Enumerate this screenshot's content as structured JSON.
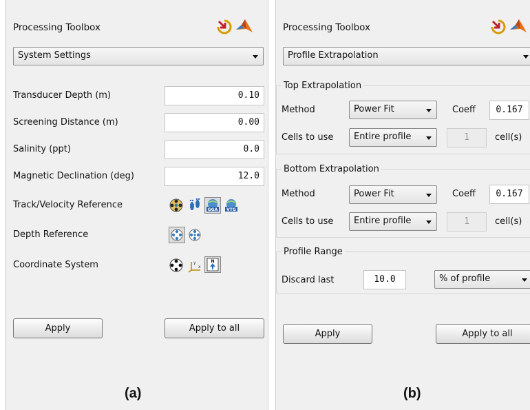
{
  "panel_a": {
    "title": "Processing Toolbox",
    "category": "System Settings",
    "fields": [
      {
        "label": "Transducer Depth (m)",
        "value": "0.10"
      },
      {
        "label": "Screening Distance (m)",
        "value": "0.00"
      },
      {
        "label": "Salinity (ppt)",
        "value": "0.0"
      },
      {
        "label": "Magnetic Declination (deg)",
        "value": "12.0"
      }
    ],
    "track_reference_label": "Track/Velocity Reference",
    "track_reference_icons": [
      "bottom-track-icon",
      "footprints-icon",
      "gga-icon",
      "vtg-icon"
    ],
    "track_reference_gga_text": "GGA",
    "track_reference_vtg_text": "VTG",
    "depth_reference_label": "Depth Reference",
    "depth_reference_icons": [
      "depth-average-icon",
      "depth-beams-icon"
    ],
    "coordinate_system_label": "Coordinate System",
    "coordinate_system_icons": [
      "beam-coordinates-icon",
      "xyz-axes-icon",
      "north-arrow-icon"
    ],
    "north_text": "N",
    "apply_label": "Apply",
    "apply_all_label": "Apply to all",
    "caption": "(a)"
  },
  "panel_b": {
    "title": "Processing Toolbox",
    "category": "Profile Extrapolation",
    "top": {
      "group_title": "Top Extrapolation",
      "method_label": "Method",
      "method_value": "Power Fit",
      "coeff_label": "Coeff",
      "coeff_value": "0.167",
      "cells_label": "Cells to use",
      "cells_value": "Entire profile",
      "cells_count": "1",
      "cells_unit": "cell(s)"
    },
    "bottom": {
      "group_title": "Bottom Extrapolation",
      "method_label": "Method",
      "method_value": "Power Fit",
      "coeff_label": "Coeff",
      "coeff_value": "0.167",
      "cells_label": "Cells to use",
      "cells_value": "Entire profile",
      "cells_count": "1",
      "cells_unit": "cell(s)"
    },
    "range": {
      "group_title": "Profile Range",
      "discard_label": "Discard last",
      "discard_value": "10.0",
      "unit_value": "% of profile"
    },
    "apply_label": "Apply",
    "apply_all_label": "Apply to all",
    "caption": "(b)"
  },
  "colors": {
    "panel_bg": "#f0f0f0",
    "matlab_orange": "#e8731a",
    "undock_yellow": "#f0b400",
    "icon_blue": "#2f6fb5"
  }
}
